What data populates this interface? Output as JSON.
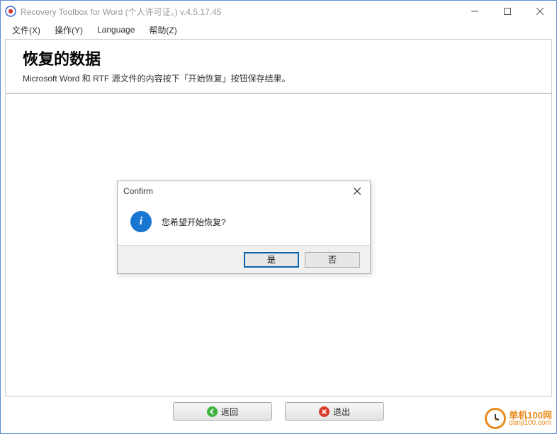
{
  "titlebar": {
    "title": "Recovery Toolbox for Word (个人许可证。) v.4.5.17.45"
  },
  "menu": {
    "file": "文件(X)",
    "action": "操作(Y)",
    "language": "Language",
    "help": "帮助(Z)"
  },
  "header": {
    "title": "恢复的数据",
    "subtitle": "Microsoft Word 和 RTF 源文件的内容按下「开始恢复」按钮保存结果。"
  },
  "dialog": {
    "title": "Confirm",
    "message": "您希望开始恢复?",
    "yes": "是",
    "no": "否"
  },
  "buttons": {
    "back": "返回",
    "exit": "退出"
  },
  "watermark": {
    "line1": "单机100网",
    "line2": "danji100.com"
  }
}
